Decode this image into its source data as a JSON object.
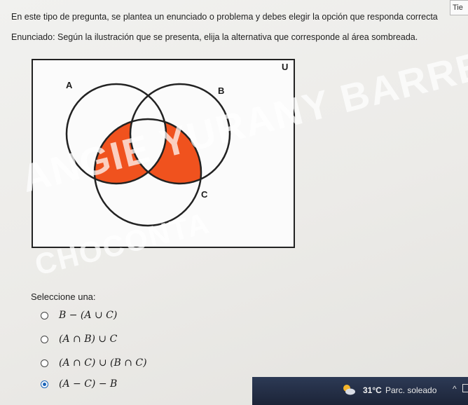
{
  "timer": {
    "label": "Tie"
  },
  "question": {
    "instructions": "En este tipo de pregunta, se plantea un enunciado o problema y debes elegir la opción que responda correcta",
    "statement": "Enunciado: Según la ilustración que se presenta, elija la alternativa que corresponde al área sombreada."
  },
  "venn": {
    "universe_label": "U",
    "set_labels": {
      "a": "A",
      "b": "B",
      "c": "C"
    },
    "shade_color": "#f0521e"
  },
  "watermark": {
    "line1": "ANGIE YURANY BARRERA",
    "line2": "CHOCONTA"
  },
  "answers": {
    "prompt": "Seleccione una:",
    "options": [
      {
        "text": "B − (A ∪ C)",
        "selected": false
      },
      {
        "text": "(A ∩ B) ∪ C",
        "selected": false
      },
      {
        "text": "(A ∩ C) ∪ (B ∩ C)",
        "selected": false
      },
      {
        "text": "(A − C) − B",
        "selected": true
      }
    ]
  },
  "taskbar": {
    "temperature": "31°C",
    "weather": "Parc. soleado",
    "weather_icon": "partly-sunny-icon",
    "overflow_icon": "chevron-up-icon"
  }
}
